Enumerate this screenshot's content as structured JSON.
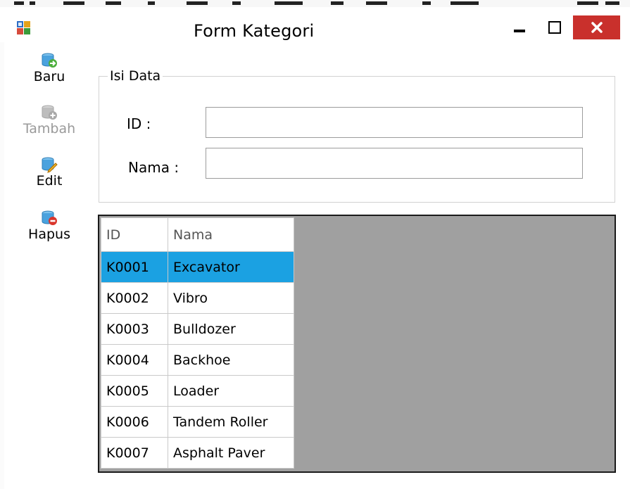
{
  "window": {
    "title": "Form Kategori"
  },
  "toolbar": {
    "items": [
      {
        "label": "Baru",
        "icon": "database-arrow-icon",
        "enabled": true
      },
      {
        "label": "Tambah",
        "icon": "database-add-icon",
        "enabled": false
      },
      {
        "label": "Edit",
        "icon": "database-edit-icon",
        "enabled": true
      },
      {
        "label": "Hapus",
        "icon": "database-delete-icon",
        "enabled": true
      }
    ]
  },
  "form": {
    "group_title": "Isi Data",
    "id_label": "ID :",
    "id_value": "",
    "nama_label": "Nama :",
    "nama_value": ""
  },
  "grid": {
    "columns": [
      "ID",
      "Nama"
    ],
    "rows": [
      {
        "id": "K0001",
        "nama": "Excavator",
        "selected": true
      },
      {
        "id": "K0002",
        "nama": "Vibro"
      },
      {
        "id": "K0003",
        "nama": "Bulldozer"
      },
      {
        "id": "K0004",
        "nama": "Backhoe"
      },
      {
        "id": "K0005",
        "nama": "Loader"
      },
      {
        "id": "K0006",
        "nama": "Tandem Roller"
      },
      {
        "id": "K0007",
        "nama": "Asphalt Paver"
      }
    ]
  },
  "colors": {
    "selection": "#1ba1e2",
    "close_button": "#c9302c",
    "grid_background": "#a0a0a0"
  }
}
